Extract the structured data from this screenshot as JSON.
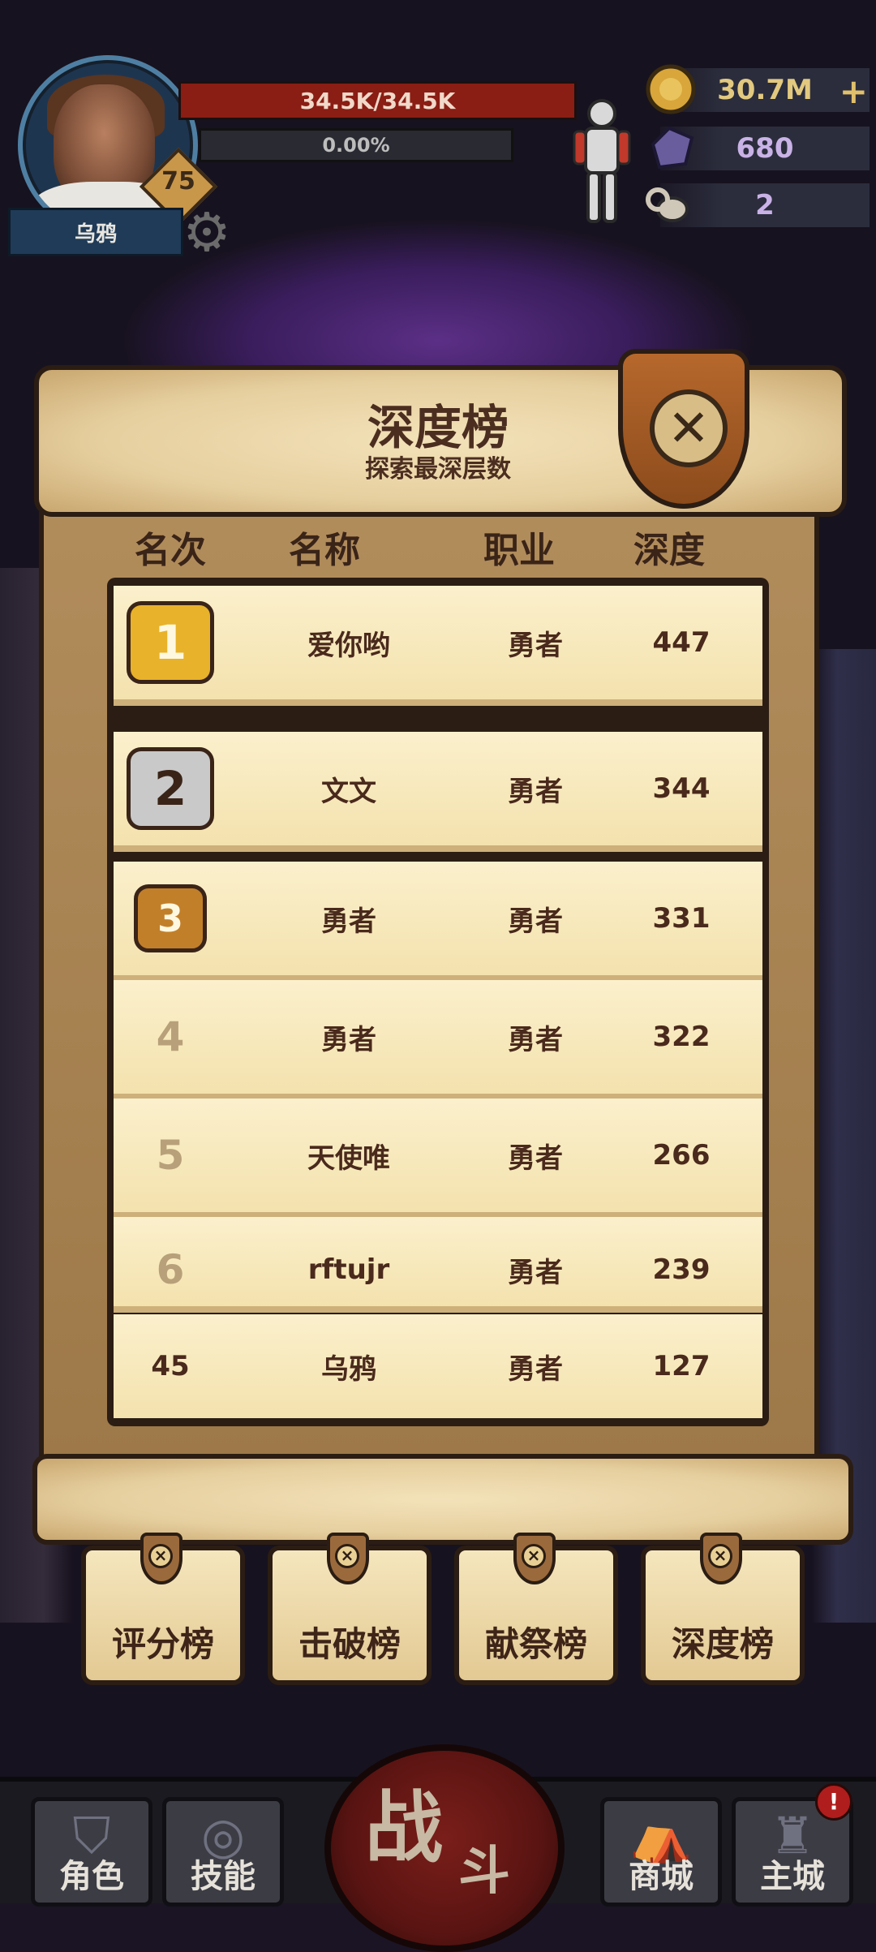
{
  "player": {
    "name": "乌鸦",
    "level": "75",
    "hp": "34.5K/34.5K",
    "xp_percent": "0.00%",
    "xp_fraction": 0
  },
  "resources": {
    "gold": "30.7M",
    "gems": "680",
    "keys": "2"
  },
  "panel": {
    "title": "深度榜",
    "subtitle": "探索最深层数",
    "columns": [
      "名次",
      "名称",
      "职业",
      "深度"
    ]
  },
  "rows": [
    {
      "rank": "1",
      "name": "爱你哟",
      "class": "勇者",
      "depth": "447"
    },
    {
      "rank": "2",
      "name": "文文",
      "class": "勇者",
      "depth": "344"
    },
    {
      "rank": "3",
      "name": "勇者",
      "class": "勇者",
      "depth": "331"
    },
    {
      "rank": "4",
      "name": "勇者",
      "class": "勇者",
      "depth": "322"
    },
    {
      "rank": "5",
      "name": "天使唯",
      "class": "勇者",
      "depth": "266"
    },
    {
      "rank": "6",
      "name": "rftujr",
      "class": "勇者",
      "depth": "239"
    },
    {
      "rank": "45",
      "name": "乌鸦",
      "class": "勇者",
      "depth": "127"
    }
  ],
  "tabs": [
    {
      "label": "评分榜"
    },
    {
      "label": "击破榜"
    },
    {
      "label": "献祭榜"
    },
    {
      "label": "深度榜"
    }
  ],
  "nav": {
    "character": "角色",
    "skills": "技能",
    "battle_main": "战",
    "battle_sub": "斗",
    "shop": "商城",
    "main_city": "主城",
    "alert": "!"
  },
  "colors": {
    "gold_medal": "#e8b22a",
    "silver_medal": "#c9c9c9",
    "bronze_medal": "#c27f2a",
    "parchment": "#f4e2ae",
    "hp_red": "#8a1d14"
  }
}
